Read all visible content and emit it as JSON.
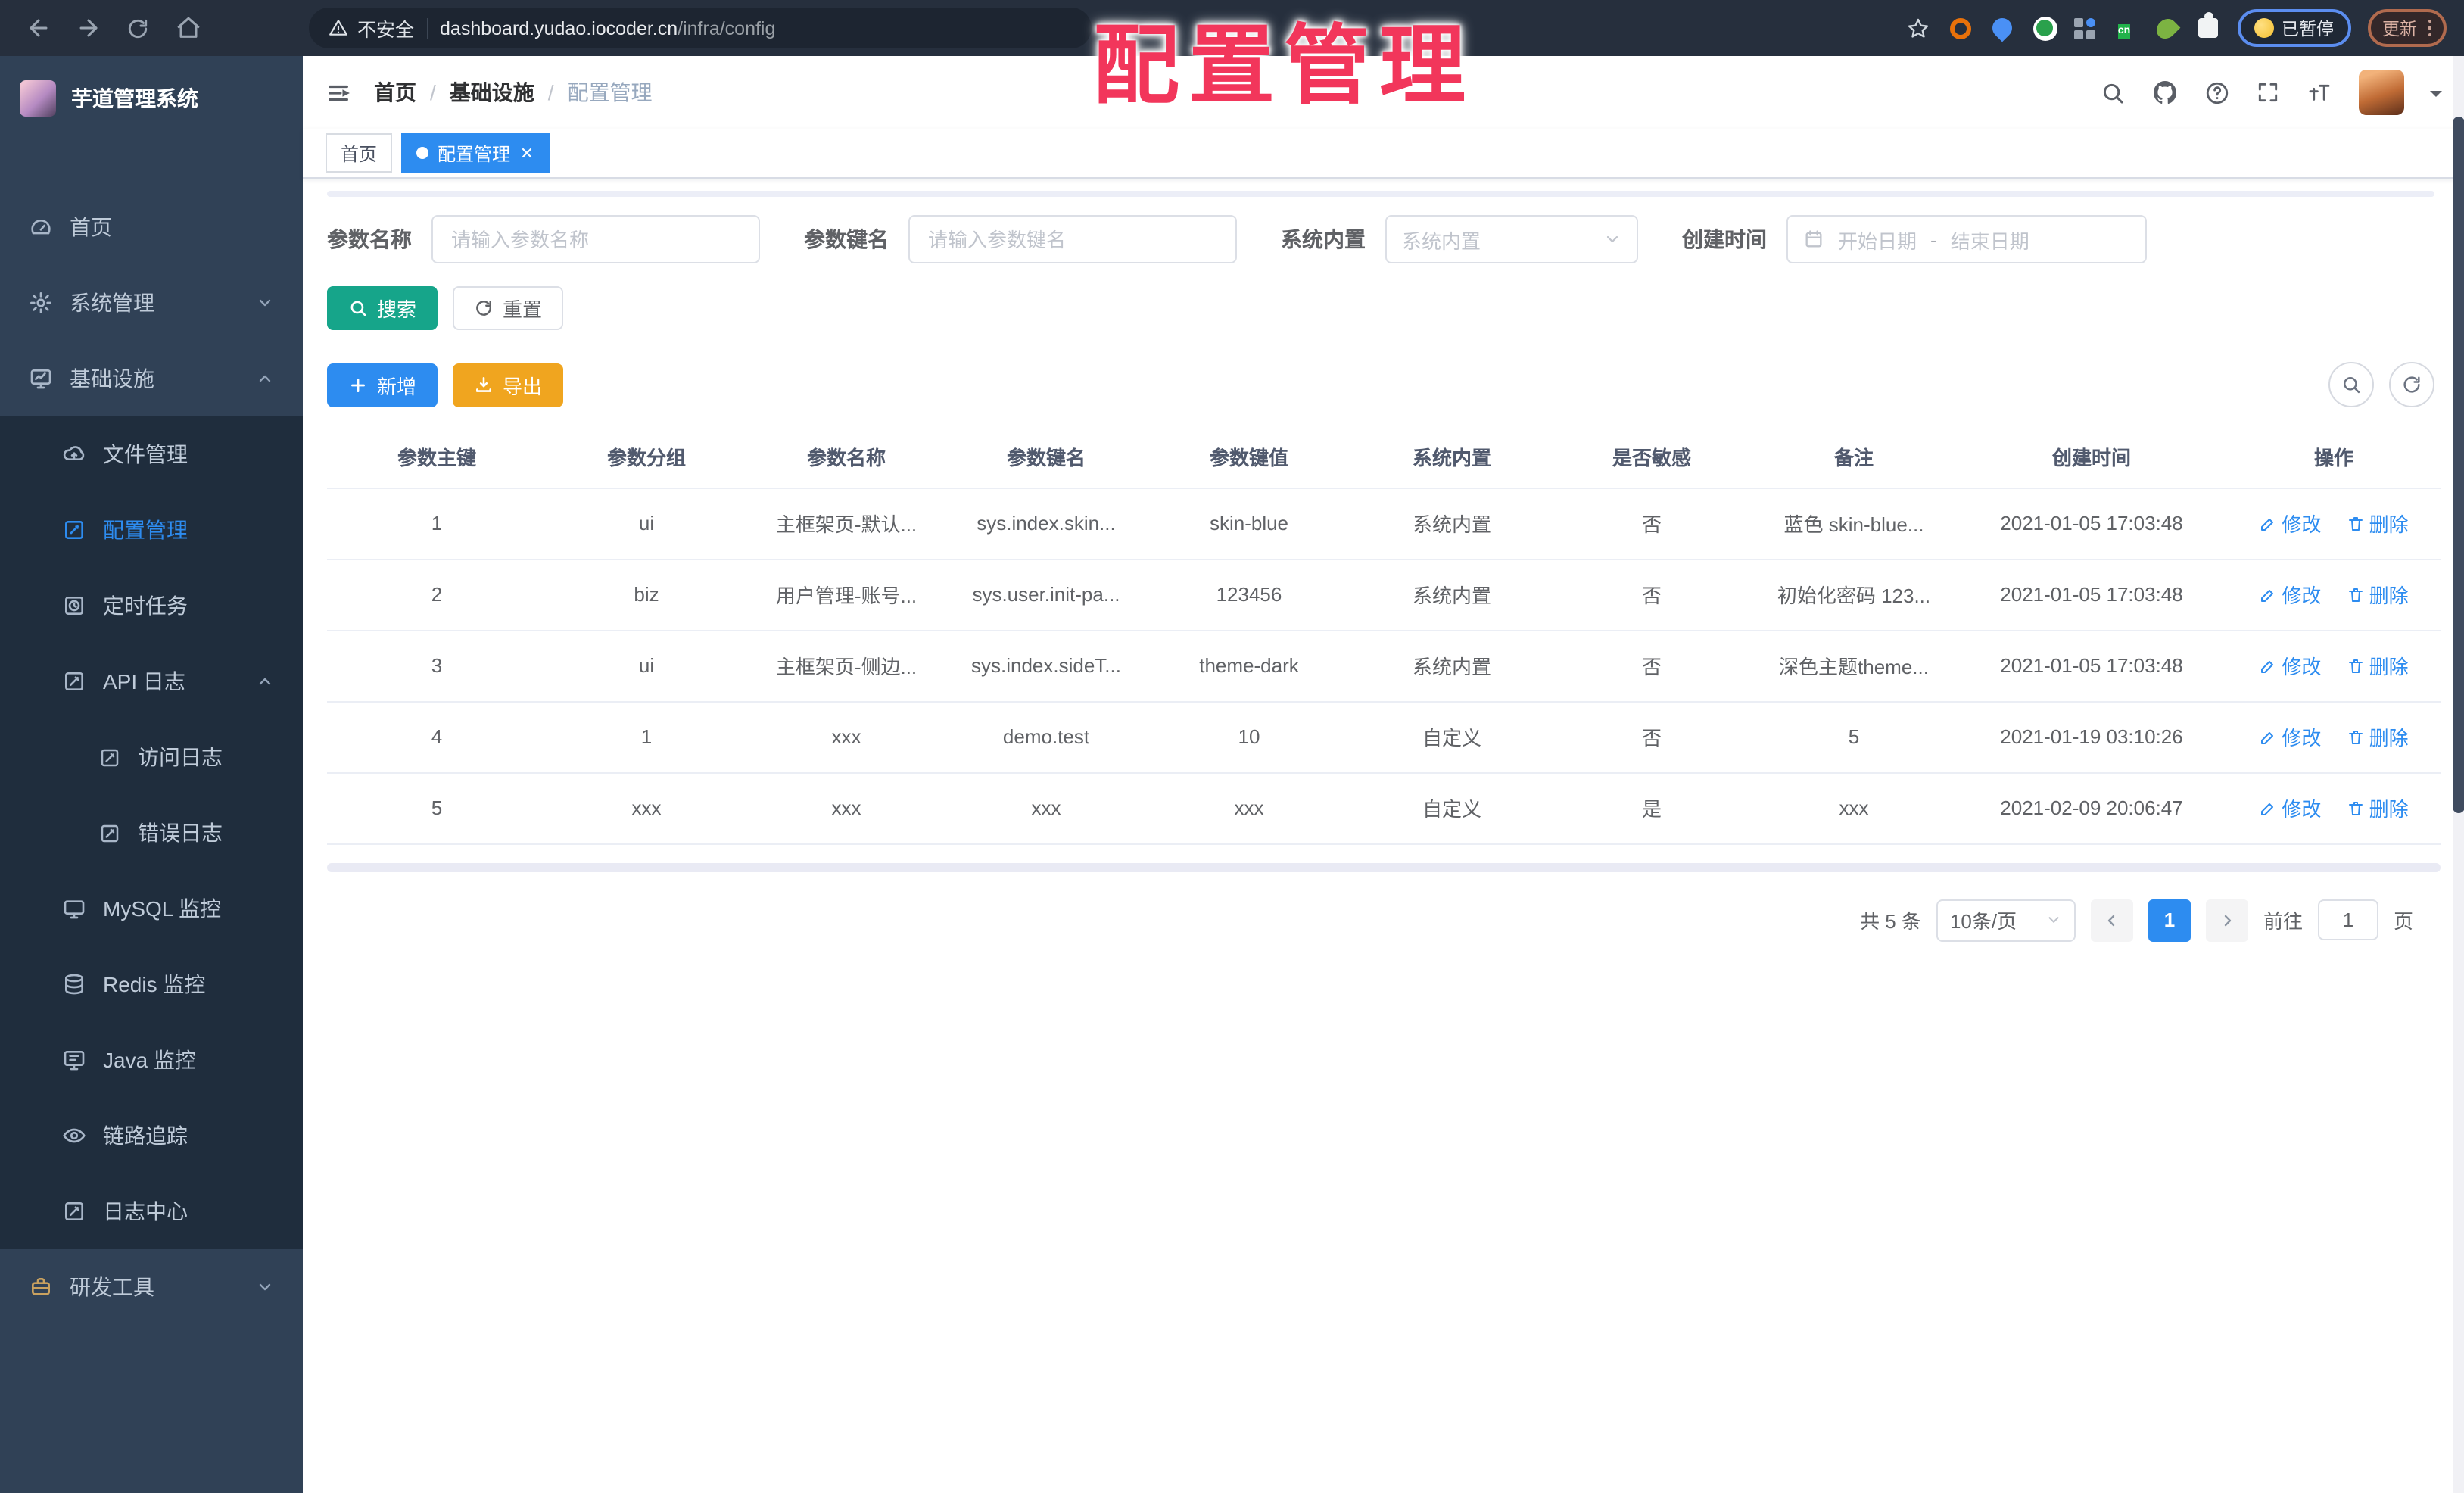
{
  "browser": {
    "security_label": "不安全",
    "url_host": "dashboard.yudao.iocoder.cn",
    "url_path": "/infra/config",
    "ext_cn_badge": "cn",
    "paused_badge": "已暂停",
    "update_button": "更新"
  },
  "watermark": "配置管理",
  "sidebar": {
    "app_title": "芋道管理系统",
    "home": "首页",
    "system": "系统管理",
    "infra": "基础设施",
    "infra_children": {
      "file": "文件管理",
      "config": "配置管理",
      "job": "定时任务",
      "api_log": "API 日志",
      "access_log": "访问日志",
      "error_log": "错误日志",
      "mysql": "MySQL 监控",
      "redis": "Redis 监控",
      "java": "Java 监控",
      "trace": "链路追踪",
      "log_center": "日志中心"
    },
    "dev_tools": "研发工具"
  },
  "header": {
    "breadcrumb": [
      "首页",
      "基础设施",
      "配置管理"
    ],
    "separator": "/"
  },
  "tags": [
    {
      "label": "首页"
    },
    {
      "label": "配置管理"
    }
  ],
  "filters": {
    "name_label": "参数名称",
    "name_placeholder": "请输入参数名称",
    "key_label": "参数键名",
    "key_placeholder": "请输入参数键名",
    "type_label": "系统内置",
    "type_placeholder": "系统内置",
    "date_label": "创建时间",
    "date_start_placeholder": "开始日期",
    "date_separator": "-",
    "date_end_placeholder": "结束日期"
  },
  "toolbar": {
    "search": "搜索",
    "reset": "重置",
    "add": "新增",
    "export": "导出"
  },
  "table": {
    "columns": [
      "参数主键",
      "参数分组",
      "参数名称",
      "参数键名",
      "参数键值",
      "系统内置",
      "是否敏感",
      "备注",
      "创建时间",
      "操作"
    ],
    "actions": {
      "edit": "修改",
      "delete": "删除"
    },
    "rows": [
      {
        "id": "1",
        "group": "ui",
        "name": "主框架页-默认...",
        "key": "sys.index.skin...",
        "value": "skin-blue",
        "type": "系统内置",
        "sensitive": "否",
        "remark": "蓝色 skin-blue...",
        "created": "2021-01-05 17:03:48"
      },
      {
        "id": "2",
        "group": "biz",
        "name": "用户管理-账号...",
        "key": "sys.user.init-pa...",
        "value": "123456",
        "type": "系统内置",
        "sensitive": "否",
        "remark": "初始化密码 123...",
        "created": "2021-01-05 17:03:48"
      },
      {
        "id": "3",
        "group": "ui",
        "name": "主框架页-侧边...",
        "key": "sys.index.sideT...",
        "value": "theme-dark",
        "type": "系统内置",
        "sensitive": "否",
        "remark": "深色主题theme...",
        "created": "2021-01-05 17:03:48"
      },
      {
        "id": "4",
        "group": "1",
        "name": "xxx",
        "key": "demo.test",
        "value": "10",
        "type": "自定义",
        "sensitive": "否",
        "remark": "5",
        "created": "2021-01-19 03:10:26"
      },
      {
        "id": "5",
        "group": "xxx",
        "name": "xxx",
        "key": "xxx",
        "value": "xxx",
        "type": "自定义",
        "sensitive": "是",
        "remark": "xxx",
        "created": "2021-02-09 20:06:47"
      }
    ]
  },
  "pagination": {
    "total": "共 5 条",
    "page_size": "10条/页",
    "current_page": "1",
    "goto_label": "前往",
    "goto_value": "1",
    "page_unit": "页"
  },
  "icons": {
    "browser": [
      "back-icon",
      "forward-icon",
      "reload-icon",
      "home-icon",
      "warning-icon",
      "star-icon",
      "extension-icons",
      "kebab-menu-icon"
    ],
    "header": [
      "hamburger-icon",
      "search-icon",
      "github-icon",
      "question-icon",
      "fullscreen-icon",
      "font-size-icon"
    ],
    "colors": {
      "primary": "#2d8cf0",
      "success": "#16a58a",
      "warning": "#f0a51f",
      "sidebar_bg": "#304156",
      "submenu_bg": "#1f2d3d",
      "annotation_red": "#f2365b"
    }
  }
}
